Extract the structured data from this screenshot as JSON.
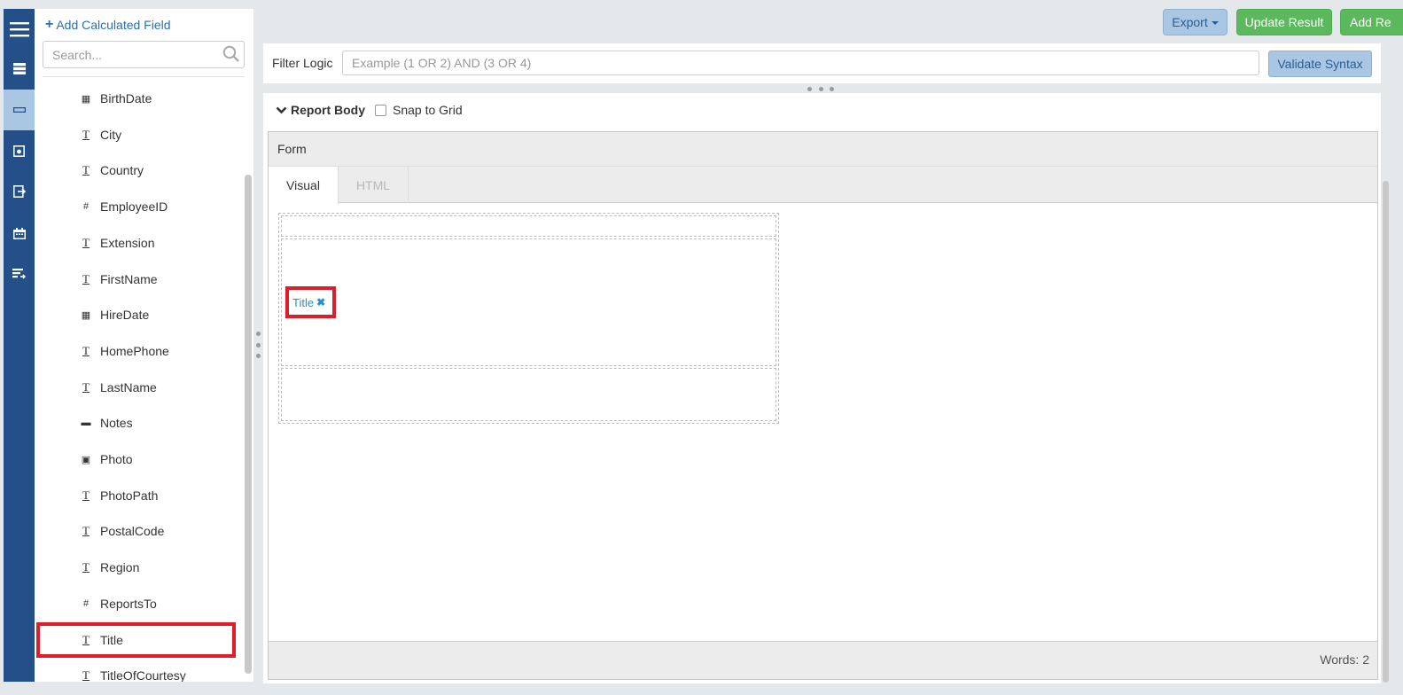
{
  "sidebar": {
    "rail_icons": [
      "menu-icon",
      "list-icon",
      "minus-icon",
      "safe-icon",
      "export-icon",
      "calendar-icon",
      "sort-list-icon"
    ],
    "active_rail_index": 2
  },
  "field_panel": {
    "add_calculated_field": "Add Calculated Field",
    "search_placeholder": "Search...",
    "fields": [
      {
        "label": "BirthDate",
        "type": "calendar-icon",
        "glyph": "▦"
      },
      {
        "label": "City",
        "type": "text-icon",
        "glyph": "T"
      },
      {
        "label": "Country",
        "type": "text-icon",
        "glyph": "T"
      },
      {
        "label": "EmployeeID",
        "type": "number-icon",
        "glyph": "#"
      },
      {
        "label": "Extension",
        "type": "text-icon",
        "glyph": "T"
      },
      {
        "label": "FirstName",
        "type": "text-icon",
        "glyph": "T"
      },
      {
        "label": "HireDate",
        "type": "calendar-icon",
        "glyph": "▦"
      },
      {
        "label": "HomePhone",
        "type": "text-icon",
        "glyph": "T"
      },
      {
        "label": "LastName",
        "type": "text-icon",
        "glyph": "T"
      },
      {
        "label": "Notes",
        "type": "memo-icon",
        "glyph": "▬"
      },
      {
        "label": "Photo",
        "type": "image-icon",
        "glyph": "▣"
      },
      {
        "label": "PhotoPath",
        "type": "text-icon",
        "glyph": "T"
      },
      {
        "label": "PostalCode",
        "type": "text-icon",
        "glyph": "T"
      },
      {
        "label": "Region",
        "type": "text-icon",
        "glyph": "T"
      },
      {
        "label": "ReportsTo",
        "type": "number-icon",
        "glyph": "#"
      },
      {
        "label": "Title",
        "type": "text-icon",
        "glyph": "T",
        "highlighted": true
      },
      {
        "label": "TitleOfCourtesy",
        "type": "text-icon",
        "glyph": "T"
      }
    ]
  },
  "toolbar": {
    "export_label": "Export",
    "update_label": "Update Result",
    "add_label": "Add Re"
  },
  "filter": {
    "label": "Filter Logic",
    "placeholder": "Example (1 OR 2) AND (3 OR 4)",
    "validate_label": "Validate Syntax"
  },
  "report_body": {
    "title": "Report Body",
    "snap_label": "Snap to Grid",
    "snap_checked": false,
    "editor": {
      "title": "Form",
      "tabs": [
        "Visual",
        "HTML"
      ],
      "active_tab": "Visual",
      "token_label": "Title",
      "token_remove_glyph": "✖",
      "words": "Words: 2"
    }
  },
  "colors": {
    "rail": "#244f88",
    "rail_active": "#a9c6e2",
    "link": "#2a6fb5",
    "success": "#5cb85c",
    "info": "#a9c6e2",
    "highlight": "#e01b2a",
    "token": "#2a8fd0"
  }
}
